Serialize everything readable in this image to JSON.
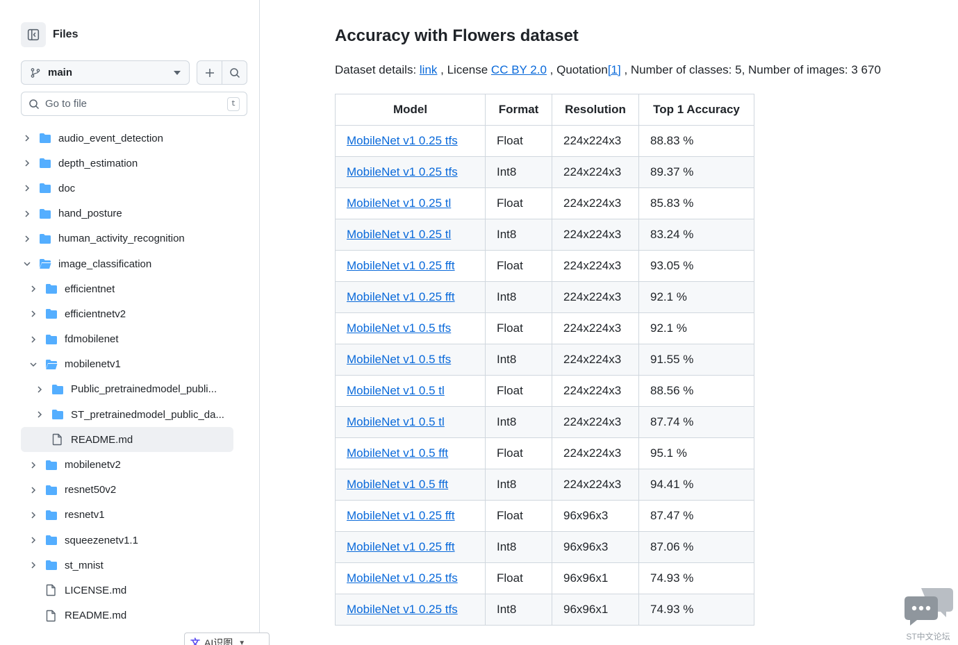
{
  "sidebar": {
    "title": "Files",
    "branch": "main",
    "search_placeholder": "Go to file",
    "search_shortcut": "t",
    "tree": [
      {
        "label": "audio_event_detection",
        "type": "folder",
        "depth": 0,
        "expanded": false
      },
      {
        "label": "depth_estimation",
        "type": "folder",
        "depth": 0,
        "expanded": false
      },
      {
        "label": "doc",
        "type": "folder",
        "depth": 0,
        "expanded": false
      },
      {
        "label": "hand_posture",
        "type": "folder",
        "depth": 0,
        "expanded": false
      },
      {
        "label": "human_activity_recognition",
        "type": "folder",
        "depth": 0,
        "expanded": false
      },
      {
        "label": "image_classification",
        "type": "folder",
        "depth": 0,
        "expanded": true
      },
      {
        "label": "efficientnet",
        "type": "folder",
        "depth": 1,
        "expanded": false
      },
      {
        "label": "efficientnetv2",
        "type": "folder",
        "depth": 1,
        "expanded": false
      },
      {
        "label": "fdmobilenet",
        "type": "folder",
        "depth": 1,
        "expanded": false
      },
      {
        "label": "mobilenetv1",
        "type": "folder",
        "depth": 1,
        "expanded": true
      },
      {
        "label": "Public_pretrainedmodel_publi...",
        "type": "folder",
        "depth": 2,
        "expanded": false
      },
      {
        "label": "ST_pretrainedmodel_public_da...",
        "type": "folder",
        "depth": 2,
        "expanded": false
      },
      {
        "label": "README.md",
        "type": "file",
        "depth": 2,
        "active": true
      },
      {
        "label": "mobilenetv2",
        "type": "folder",
        "depth": 1,
        "expanded": false
      },
      {
        "label": "resnet50v2",
        "type": "folder",
        "depth": 1,
        "expanded": false
      },
      {
        "label": "resnetv1",
        "type": "folder",
        "depth": 1,
        "expanded": false
      },
      {
        "label": "squeezenetv1.1",
        "type": "folder",
        "depth": 1,
        "expanded": false
      },
      {
        "label": "st_mnist",
        "type": "folder",
        "depth": 1,
        "expanded": false
      },
      {
        "label": "LICENSE.md",
        "type": "file",
        "depth": 1
      },
      {
        "label": "README.md",
        "type": "file",
        "depth": 1
      }
    ]
  },
  "ai_popup": {
    "glyph": "文",
    "label": "AI识图"
  },
  "main": {
    "title": "Accuracy with Flowers dataset",
    "details": {
      "prefix": "Dataset details: ",
      "link_label": "link",
      "license_prefix": " , License ",
      "license_label": "CC BY 2.0",
      "quotation_prefix": " , Quotation",
      "quotation_label": "[1]",
      "suffix": " , Number of classes: 5, Number of images: 3 670"
    },
    "table": {
      "headers": [
        "Model",
        "Format",
        "Resolution",
        "Top 1 Accuracy"
      ],
      "rows": [
        [
          "MobileNet v1 0.25 tfs",
          "Float",
          "224x224x3",
          "88.83 %"
        ],
        [
          "MobileNet v1 0.25 tfs",
          "Int8",
          "224x224x3",
          "89.37 %"
        ],
        [
          "MobileNet v1 0.25 tl",
          "Float",
          "224x224x3",
          "85.83 %"
        ],
        [
          "MobileNet v1 0.25 tl",
          "Int8",
          "224x224x3",
          "83.24 %"
        ],
        [
          "MobileNet v1 0.25 fft",
          "Float",
          "224x224x3",
          "93.05 %"
        ],
        [
          "MobileNet v1 0.25 fft",
          "Int8",
          "224x224x3",
          "92.1 %"
        ],
        [
          "MobileNet v1 0.5 tfs",
          "Float",
          "224x224x3",
          "92.1 %"
        ],
        [
          "MobileNet v1 0.5 tfs",
          "Int8",
          "224x224x3",
          "91.55 %"
        ],
        [
          "MobileNet v1 0.5 tl",
          "Float",
          "224x224x3",
          "88.56 %"
        ],
        [
          "MobileNet v1 0.5 tl",
          "Int8",
          "224x224x3",
          "87.74 %"
        ],
        [
          "MobileNet v1 0.5 fft",
          "Float",
          "224x224x3",
          "95.1 %"
        ],
        [
          "MobileNet v1 0.5 fft",
          "Int8",
          "224x224x3",
          "94.41 %"
        ],
        [
          "MobileNet v1 0.25 fft",
          "Float",
          "96x96x3",
          "87.47 %"
        ],
        [
          "MobileNet v1 0.25 fft",
          "Int8",
          "96x96x3",
          "87.06 %"
        ],
        [
          "MobileNet v1 0.25 tfs",
          "Float",
          "96x96x1",
          "74.93 %"
        ],
        [
          "MobileNet v1 0.25 tfs",
          "Int8",
          "96x96x1",
          "74.93 %"
        ]
      ]
    }
  },
  "watermark": {
    "label": "ST中文论坛"
  },
  "colors": {
    "link": "#0969da",
    "folder": "#54aeff",
    "border": "#d0d7de",
    "stripe": "#f6f8fa"
  }
}
